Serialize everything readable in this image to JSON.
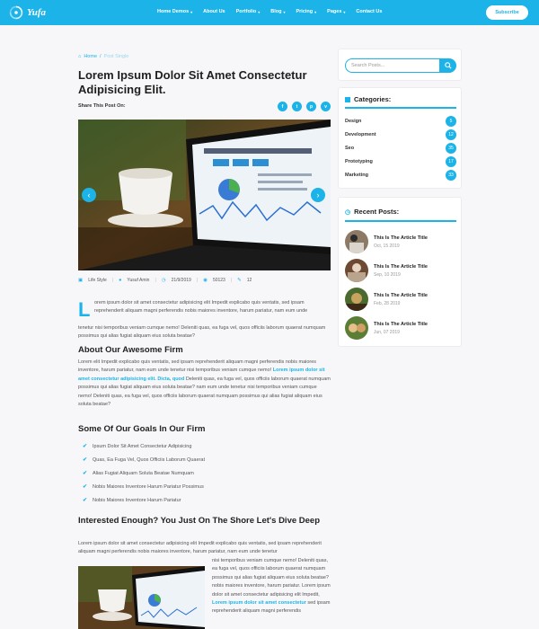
{
  "brand": {
    "name": "Yufa"
  },
  "nav": {
    "items": [
      {
        "label": "Home Demos",
        "has_dropdown": true
      },
      {
        "label": "About Us",
        "has_dropdown": false
      },
      {
        "label": "Portfolio",
        "has_dropdown": true
      },
      {
        "label": "Blog",
        "has_dropdown": true
      },
      {
        "label": "Pricing",
        "has_dropdown": true
      },
      {
        "label": "Pages",
        "has_dropdown": true
      },
      {
        "label": "Contact Us",
        "has_dropdown": false
      }
    ],
    "subscribe_label": "Subscribe"
  },
  "breadcrumb": {
    "home": "Home",
    "separator": "/",
    "current": "Post Single"
  },
  "article": {
    "title": "Lorem Ipsum Dolor Sit Amet Consectetur Adipisicing Elit.",
    "share_label": "Share This Post On:",
    "share_icons": [
      "facebook-icon",
      "twitter-icon",
      "pinterest-icon",
      "vimeo-icon"
    ],
    "meta": {
      "category": "Life Style",
      "author": "Yusuf Amin",
      "date": "21/9/2019",
      "views": "50123",
      "comments": "12"
    },
    "dropcap": "L",
    "intro_first": "orem ipsum dolor sit amet consectetur adipisicing elit Impedit explicabo quis ventatis, sed ipsam reprehenderit aliquam magni perferendis nobis maiores inventore, harum pariatur, nam eum unde",
    "intro_rest": "tenetur nisi temporibus veniam cumque nemo! Deleniti quas, ea fuga vel, quos officiis laborum quaerat numquam possimus qui alias fugiat aliquam eius soluta beatae?",
    "section1_title": "About Our Awesome Firm",
    "section1_before": "Lorem elit Impedit explicabo quis ventatis, sed ipsam reprehenderit aliquam magni perferendis nobis maiores inventore, harum pariatur, nam eum unde tenetur nisi temporibus veniam cumque nemo!",
    "section1_highlight": "Lorem ipsum dolor sit amet consectetur adipisicing elit. Dicta, quod",
    "section1_after": "Deleniti quas, ea fuga vel, quos officiis laborum quaerat numquam possimus qui alias fugiat aliquam eius soluta beatae? nam eum unde tenetur nisi temporibus veniam cumque nemo! Deleniti quas, ea fuga vel, quos officiis laborum quaerat numquam possimus qui alias fugiat aliquam eius soluta beatae?",
    "section2_title": "Some Of Our Goals In Our Firm",
    "goals": [
      "Ipsum Dolor Sit Amet Consectetur Adipisicing",
      "Quas, Ea Fuga Vel, Quos Officiis Laborum Quaerat",
      "Alias Fugiat Aliquam Soluta Beatae Numquam",
      "Nobis Maiores Inventore Harum Pariatur Possimus",
      "Nobis Maiores Inventore Harum Pariatur"
    ],
    "section3_title": "Interested Enough? You Just On The Shore Let's Dive Deep",
    "section3_para": "Lorem ipsum dolor sit amet consectetur adipisicing elit Impedit explicabo quis ventatis, sed ipsam reprehenderit aliquam magni perferendis nobis maiores inventore, harum pariatur, nam eum unde tenetur",
    "section3_side_before": "nisi temporibus veniam cumque nemo! Deleniti quas, ea fuga vel, quos officiis laborum quaerat numquam possimus qui alias fugiat aliquam eius soluta beatae? nobis maiores inventore, harum pariatur. Lorem ipsum dolor sit amet consectetur adipisicing elit Impedit,",
    "section3_side_highlight": "Lorem ipsum dolor sit amet consectetur",
    "section3_side_after": "sed ipsam reprehenderit aliquam magni perferendis"
  },
  "sidebar": {
    "search_placeholder": "Search Posts...",
    "categories_title": "Categories:",
    "categories": [
      {
        "name": "Design",
        "count": "5"
      },
      {
        "name": "Development",
        "count": "12"
      },
      {
        "name": "Seo",
        "count": "35"
      },
      {
        "name": "Prototyping",
        "count": "17"
      },
      {
        "name": "Marketing",
        "count": "33"
      }
    ],
    "recent_title": "Recent Posts:",
    "recent_posts": [
      {
        "title": "This Is The Article Title",
        "date": "Oct, 15 2019"
      },
      {
        "title": "This Is The Article Title",
        "date": "Sep, 10 2019"
      },
      {
        "title": "This Is The Article Title",
        "date": "Feb, 28 2019"
      },
      {
        "title": "This Is The Article Title",
        "date": "Jun, 07 2019"
      }
    ]
  },
  "colors": {
    "accent": "#1cb3e8",
    "background": "#f7f7f9"
  }
}
